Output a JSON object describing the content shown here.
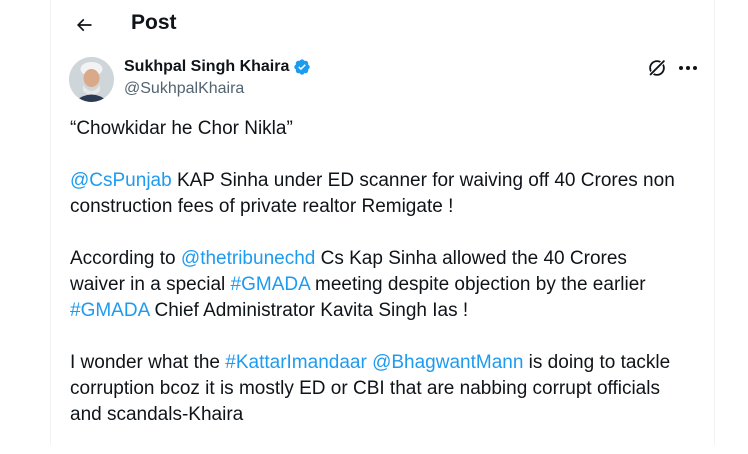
{
  "header": {
    "title": "Post",
    "back_icon": "arrow-left-icon"
  },
  "author": {
    "name": "Sukhpal Singh Khaira",
    "handle": "@SukhpalKhaira",
    "verified_icon": "verified-badge-icon",
    "verified_color": "#1d9bf0"
  },
  "actions": {
    "grok_icon": "grok-icon",
    "more_icon": "more-icon"
  },
  "post": {
    "line1": "“Chowkidar he Chor Nikla”",
    "p2_mention": "@CsPunjab",
    "p2_text_a": " KAP Sinha under ED scanner for waiving off 40 Crores non",
    "p2_text_b": "construction fees of private realtor Remigate !",
    "p3_text_a": "According to ",
    "p3_mention": "@thetribunechd",
    "p3_text_b": " Cs Kap Sinha allowed the 40 Crores",
    "p3_text_c": "waiver in a special ",
    "p3_hashtag1": "#GMADA",
    "p3_text_d": " meeting despite objection by the earlier",
    "p3_hashtag2": "#GMADA",
    "p3_text_e": " Chief Administrator Kavita Singh Ias  !",
    "p4_text_a": "I wonder what the ",
    "p4_hashtag": "#KattarImandaar",
    "p4_space": " ",
    "p4_mention": "@BhagwantMann",
    "p4_text_b": " is doing to tackle",
    "p4_text_c": "corruption bcoz it is mostly ED or CBI that are nabbing corrupt officials",
    "p4_text_d": "and scandals-Khaira"
  },
  "colors": {
    "link": "#1d9bf0",
    "text": "#0f1419",
    "secondary": "#536471"
  }
}
